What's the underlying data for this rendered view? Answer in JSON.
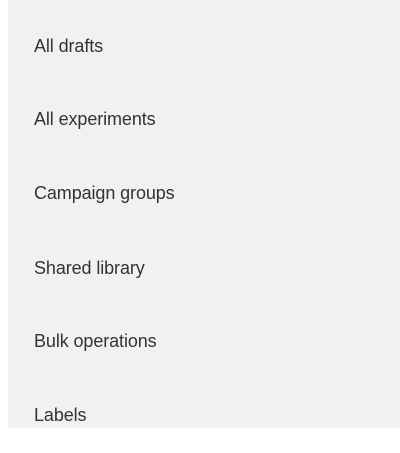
{
  "menu": {
    "items": [
      {
        "label": "All drafts"
      },
      {
        "label": "All experiments"
      },
      {
        "label": "Campaign groups"
      },
      {
        "label": "Shared library"
      },
      {
        "label": "Bulk operations"
      },
      {
        "label": "Labels"
      }
    ]
  }
}
